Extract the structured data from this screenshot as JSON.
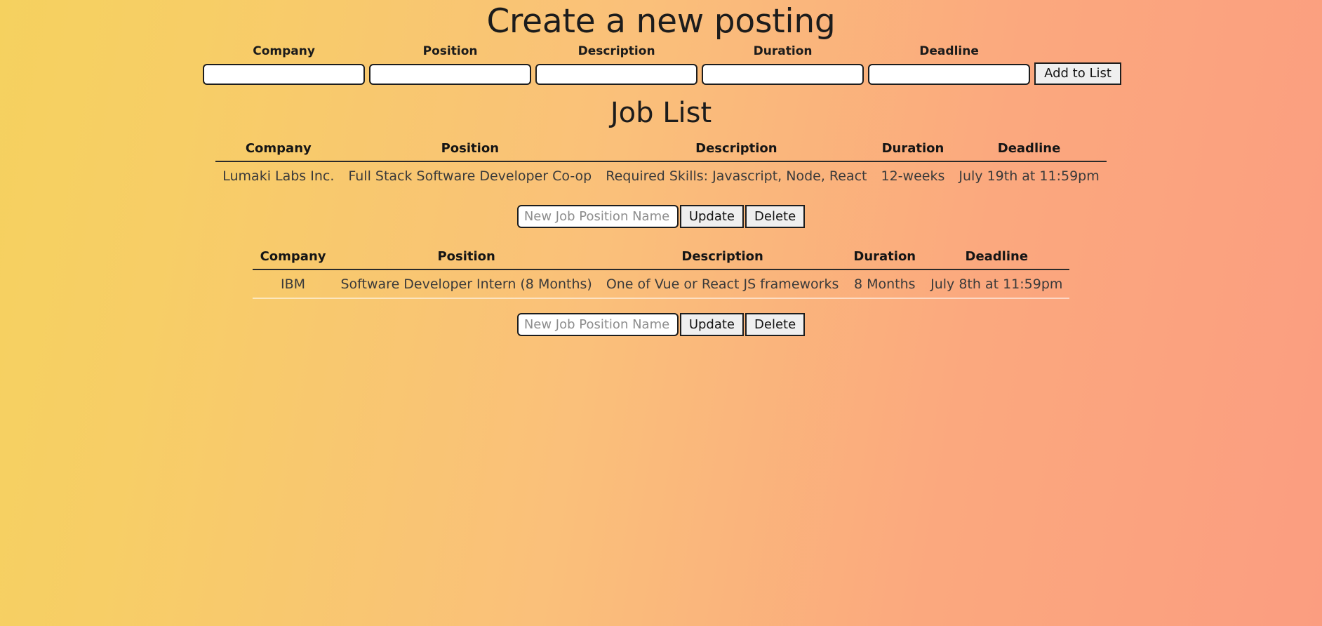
{
  "page": {
    "title": "Create a new posting",
    "list_heading": "Job List"
  },
  "create_form": {
    "fields": [
      {
        "label": "Company",
        "value": "",
        "placeholder": ""
      },
      {
        "label": "Position",
        "value": "",
        "placeholder": ""
      },
      {
        "label": "Description",
        "value": "",
        "placeholder": ""
      },
      {
        "label": "Duration",
        "value": "",
        "placeholder": ""
      },
      {
        "label": "Deadline",
        "value": "",
        "placeholder": ""
      }
    ],
    "submit_label": "Add to List"
  },
  "table_headers": {
    "company": "Company",
    "position": "Position",
    "description": "Description",
    "duration": "Duration",
    "deadline": "Deadline"
  },
  "jobs": [
    {
      "company": "Lumaki Labs Inc.",
      "position": "Full Stack Software Developer Co-op",
      "description": "Required Skills: Javascript, Node, React",
      "duration": "12-weeks",
      "deadline": "July 19th at 11:59pm",
      "rename_value": "",
      "rename_placeholder": "New Job Position Name",
      "update_label": "Update",
      "delete_label": "Delete"
    },
    {
      "company": "IBM",
      "position": "Software Developer Intern (8 Months)",
      "description": "One of Vue or React JS frameworks",
      "duration": "8 Months",
      "deadline": "July 8th at 11:59pm",
      "rename_value": "",
      "rename_placeholder": "New Job Position Name",
      "update_label": "Update",
      "delete_label": "Delete"
    }
  ],
  "colors": {
    "gradient_start": "#f5d15f",
    "gradient_end": "#fb9d80",
    "text": "#1b1b1b",
    "border": "#1d1d1d",
    "button_face": "#efefef"
  }
}
